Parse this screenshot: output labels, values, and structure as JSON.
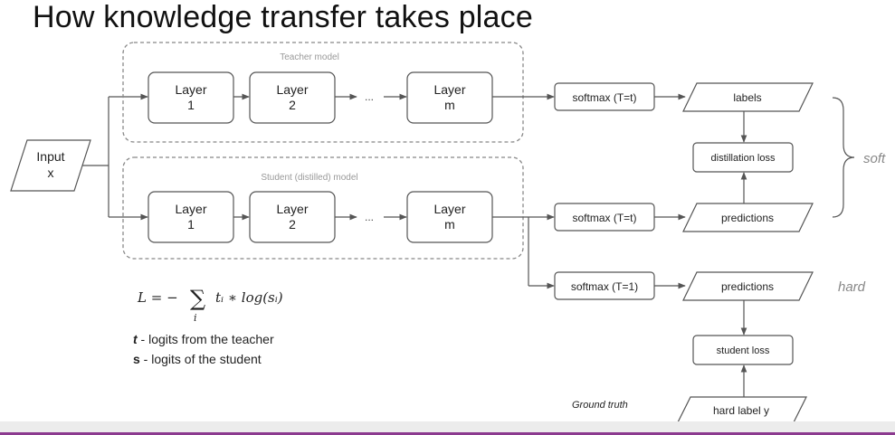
{
  "title": "How knowledge transfer takes place",
  "input": {
    "line1": "Input",
    "line2": "x"
  },
  "teacher": {
    "caption": "Teacher model",
    "layers": [
      {
        "line1": "Layer",
        "line2": "1"
      },
      {
        "line1": "Layer",
        "line2": "2"
      },
      {
        "line1": "Layer",
        "line2": "m"
      }
    ],
    "ellipsis": "..."
  },
  "student": {
    "caption": "Student (distilled) model",
    "layers": [
      {
        "line1": "Layer",
        "line2": "1"
      },
      {
        "line1": "Layer",
        "line2": "2"
      },
      {
        "line1": "Layer",
        "line2": "m"
      }
    ],
    "ellipsis": "..."
  },
  "softmax_teacher": "softmax (T=t)",
  "softmax_student_soft": "softmax (T=t)",
  "softmax_student_hard": "softmax (T=1)",
  "labels": "labels",
  "distillation_loss": "distillation loss",
  "predictions_soft": "predictions",
  "predictions_hard": "predictions",
  "student_loss": "student loss",
  "hard_label": "hard label y",
  "ground_truth": "Ground truth",
  "soft_label": "soft",
  "hard_text": "hard",
  "formula": {
    "lhs": "L = −",
    "sum": "∑",
    "sub": "i",
    "rhs": "tᵢ ∗ log(sᵢ)"
  },
  "legend": [
    {
      "symbol": "t",
      "text": " - logits from the teacher"
    },
    {
      "symbol": "s",
      "text": " - logits of the student"
    }
  ],
  "colors": {
    "accent_bar": "#8b3a8f",
    "stroke": "#555555",
    "caption": "#999999"
  }
}
